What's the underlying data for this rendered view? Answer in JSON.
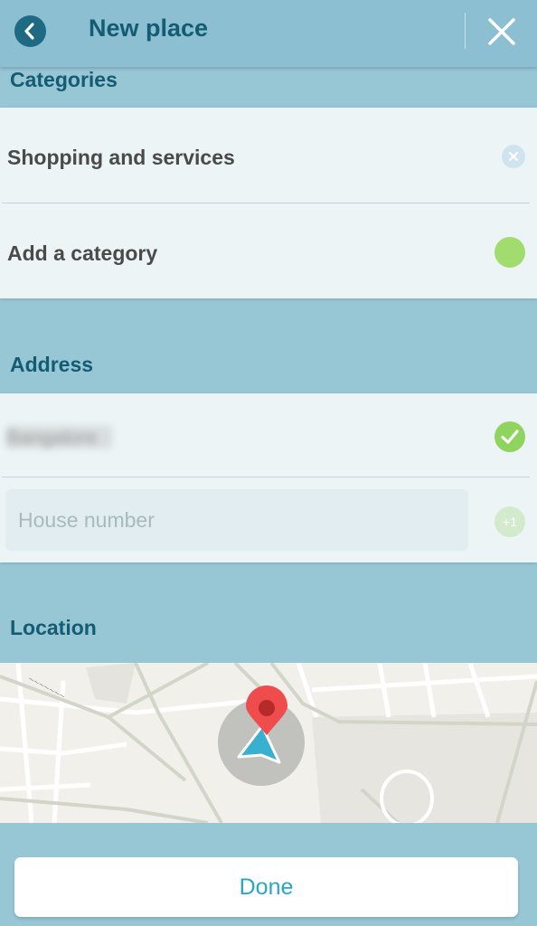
{
  "header": {
    "title": "New place"
  },
  "categories": {
    "label": "Categories",
    "items": [
      "Shopping and services"
    ],
    "add_label": "Add a category"
  },
  "address": {
    "label": "Address",
    "street_value": "Bangalore",
    "house_number_placeholder": "House number",
    "increment_label": "+1"
  },
  "location": {
    "label": "Location"
  },
  "footer": {
    "done_label": "Done"
  },
  "colors": {
    "accent": "#145c73",
    "background": "#97c6d5",
    "card": "#ecf4f6",
    "confirm_green": "#8ed45e",
    "done_text": "#2ba6c7",
    "pin_red": "#e84b4b"
  }
}
